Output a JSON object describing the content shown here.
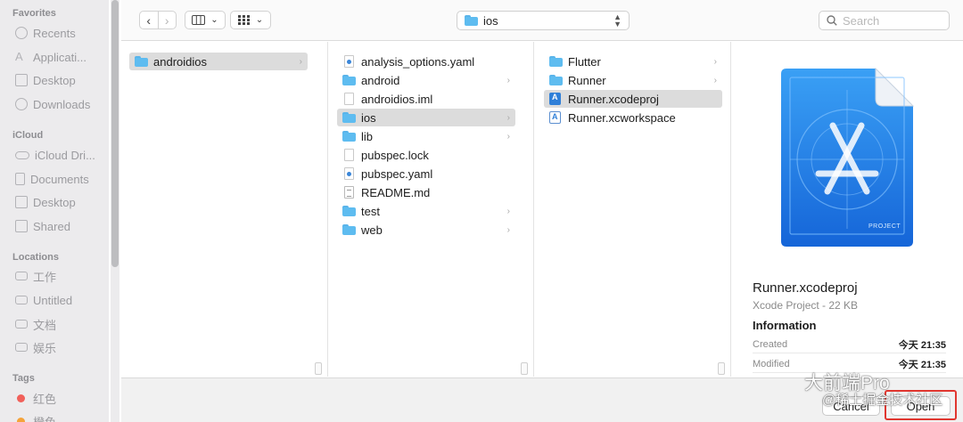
{
  "sidebar": {
    "favorites_label": "Favorites",
    "favorites": [
      {
        "label": "Recents",
        "icon": "clock-icon"
      },
      {
        "label": "Applicati...",
        "icon": "applications-icon"
      },
      {
        "label": "Desktop",
        "icon": "desktop-icon"
      },
      {
        "label": "Downloads",
        "icon": "downloads-icon"
      }
    ],
    "icloud_label": "iCloud",
    "icloud": [
      {
        "label": "iCloud Dri...",
        "icon": "cloud-icon"
      },
      {
        "label": "Documents",
        "icon": "document-icon"
      },
      {
        "label": "Desktop",
        "icon": "desktop-icon"
      },
      {
        "label": "Shared",
        "icon": "shared-folder-icon"
      }
    ],
    "locations_label": "Locations",
    "locations": [
      {
        "label": "工作",
        "icon": "drive-icon"
      },
      {
        "label": "Untitled",
        "icon": "drive-icon"
      },
      {
        "label": "文档",
        "icon": "drive-icon"
      },
      {
        "label": "娱乐",
        "icon": "drive-icon"
      }
    ],
    "tags_label": "Tags",
    "tags": [
      {
        "label": "红色",
        "color": "#f1605a"
      },
      {
        "label": "橙色",
        "color": "#f5a33a"
      }
    ]
  },
  "toolbar": {
    "back_glyph": "‹",
    "forward_glyph": "›",
    "current_folder": "ios",
    "search_placeholder": "Search"
  },
  "columns": {
    "col1": [
      {
        "name": "androidios",
        "kind": "folder",
        "selected": true,
        "chevron": true
      }
    ],
    "col2": [
      {
        "name": "analysis_options.yaml",
        "kind": "yaml"
      },
      {
        "name": "android",
        "kind": "folder",
        "chevron": true
      },
      {
        "name": "androidios.iml",
        "kind": "doc"
      },
      {
        "name": "ios",
        "kind": "folder",
        "chevron": true,
        "selected": true
      },
      {
        "name": "lib",
        "kind": "folder",
        "chevron": true
      },
      {
        "name": "pubspec.lock",
        "kind": "doc"
      },
      {
        "name": "pubspec.yaml",
        "kind": "yaml"
      },
      {
        "name": "README.md",
        "kind": "md"
      },
      {
        "name": "test",
        "kind": "folder",
        "chevron": true
      },
      {
        "name": "web",
        "kind": "folder",
        "chevron": true
      }
    ],
    "col3": [
      {
        "name": "Flutter",
        "kind": "folder",
        "chevron": true
      },
      {
        "name": "Runner",
        "kind": "folder",
        "chevron": true
      },
      {
        "name": "Runner.xcodeproj",
        "kind": "xcodeproj",
        "selected": true
      },
      {
        "name": "Runner.xcworkspace",
        "kind": "xcworkspace"
      }
    ]
  },
  "preview": {
    "badge": "PROJECT",
    "title": "Runner.xcodeproj",
    "subtitle": "Xcode Project - 22 KB",
    "info_label": "Information",
    "meta": [
      {
        "key": "Created",
        "value": "今天 21:35"
      },
      {
        "key": "Modified",
        "value": "今天 21:35"
      }
    ]
  },
  "footer": {
    "cancel_label": "Cancel",
    "open_label": "Open"
  },
  "watermark": {
    "line1": "大前端Pro",
    "line2": "@稀土掘金技术社区"
  },
  "colors": {
    "selection": "#dcdcdc",
    "folder": "#5ebcf0",
    "xcode_blue": "#2f7fd8",
    "highlight_red": "#e0362f"
  }
}
